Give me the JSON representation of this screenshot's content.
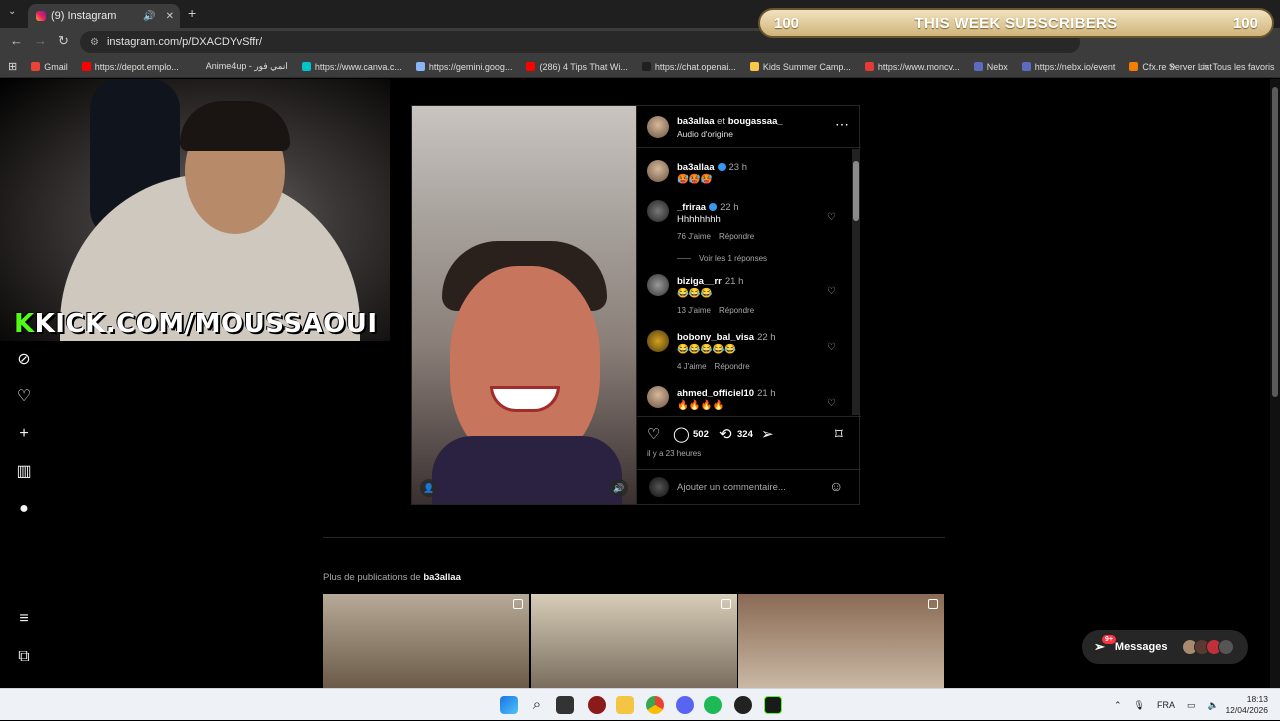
{
  "browser": {
    "tab_title": "(9) Instagram",
    "url": "instagram.com/p/DXACDYvSffr/",
    "bookmarks": [
      {
        "label": "Gmail",
        "color": "#ea4335"
      },
      {
        "label": "https://depot.emplo...",
        "color": "#ff0000"
      },
      {
        "label": "Anime4up - انمي فور",
        "color": "#3c3c3c"
      },
      {
        "label": "https://www.canva.c...",
        "color": "#00c4cc"
      },
      {
        "label": "https://gemini.goog...",
        "color": "#8ab4f8"
      },
      {
        "label": "(286) 4 Tips That Wi...",
        "color": "#ff0000"
      },
      {
        "label": "https://chat.openai...",
        "color": "#202020"
      },
      {
        "label": "Kids Summer Camp...",
        "color": "#f9c846"
      },
      {
        "label": "https://www.moncv...",
        "color": "#e53935"
      },
      {
        "label": "Nebx",
        "color": "#5c6bc0"
      },
      {
        "label": "https://nebx.io/event",
        "color": "#5c6bc0"
      },
      {
        "label": "Cfx.re Server List",
        "color": "#f57c00"
      }
    ],
    "all_favorites": "Tous les favoris"
  },
  "overlay": {
    "subs_left": "100",
    "subs_title": "THIS WEEK SUBSCRIBERS",
    "subs_right": "100",
    "kick_k": "K",
    "kick_text": "KICK.COM/MOUSSAOUI"
  },
  "post": {
    "author": "ba3allaa",
    "and": "et",
    "coauthor": "bougassaa_",
    "audio": "Audio d'origine",
    "comments": [
      {
        "user": "ba3allaa",
        "verified": true,
        "time": "23 h",
        "text": "🥵🥵🥵",
        "likes": "",
        "reply": ""
      },
      {
        "user": "_friraa",
        "verified": true,
        "time": "22 h",
        "text": "Hhhhhhhh",
        "likes": "76 J'aime",
        "reply": "Répondre"
      },
      {
        "user": "biziga__rr",
        "verified": false,
        "time": "21 h",
        "text": "😂😂😂",
        "likes": "13 J'aime",
        "reply": "Répondre"
      },
      {
        "user": "bobony_bal_visa",
        "verified": false,
        "time": "22 h",
        "text": "😂😂😂😂😂",
        "likes": "4 J'aime",
        "reply": "Répondre"
      },
      {
        "user": "ahmed_officiel10",
        "verified": false,
        "time": "21 h",
        "text": "🔥🔥🔥🔥",
        "likes": "",
        "reply": ""
      }
    ],
    "view_replies": "Voir les 1 réponses",
    "comment_count": "502",
    "repost_count": "324",
    "posted_ago": "il y a 23 heures",
    "add_comment_placeholder": "Ajouter un commentaire..."
  },
  "more": {
    "prefix": "Plus de publications de",
    "user": "ba3allaa"
  },
  "messages": {
    "label": "Messages",
    "badge": "9+"
  },
  "taskbar": {
    "lang": "FRA",
    "time": "18:13",
    "date": "12/04/2026"
  }
}
